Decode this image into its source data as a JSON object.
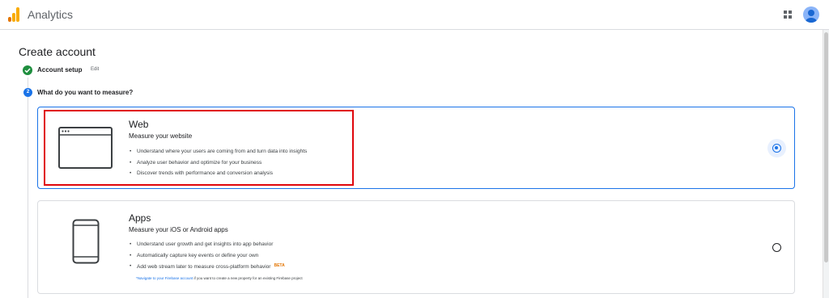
{
  "header": {
    "app_title": "Analytics",
    "icons": {
      "logo": "analytics-logo",
      "apps": "apps-grid-icon",
      "account": "account-avatar"
    }
  },
  "page": {
    "title": "Create account"
  },
  "stepper": {
    "steps": [
      {
        "number": "1",
        "label": "Account setup",
        "status": "complete",
        "edit_label": "Edit"
      },
      {
        "number": "2",
        "label": "What do you want to measure?",
        "status": "active"
      }
    ]
  },
  "options": {
    "web": {
      "title": "Web",
      "subtitle": "Measure your website",
      "bullets": [
        "Understand where your users are coming from and turn data into insights",
        "Analyze user behavior and optimize for your business",
        "Discover trends with performance and conversion analysis"
      ],
      "selected": true,
      "icon": "browser-window-icon"
    },
    "apps": {
      "title": "Apps",
      "subtitle": "Measure your iOS or Android apps",
      "bullets": [
        "Understand user growth and get insights into app behavior",
        "Automatically capture key events or define your own",
        "Add web stream later to measure cross-platform behavior"
      ],
      "beta_label": "BETA",
      "note_link": "*Navigate to your Firebase account",
      "note_text": " if you want to create a new property for an existing Firebase project",
      "selected": false,
      "icon": "mobile-phone-icon"
    }
  },
  "colors": {
    "primary": "#1a73e8",
    "success": "#1e8e3e",
    "highlight": "#e0060b",
    "beta": "#e37400"
  }
}
